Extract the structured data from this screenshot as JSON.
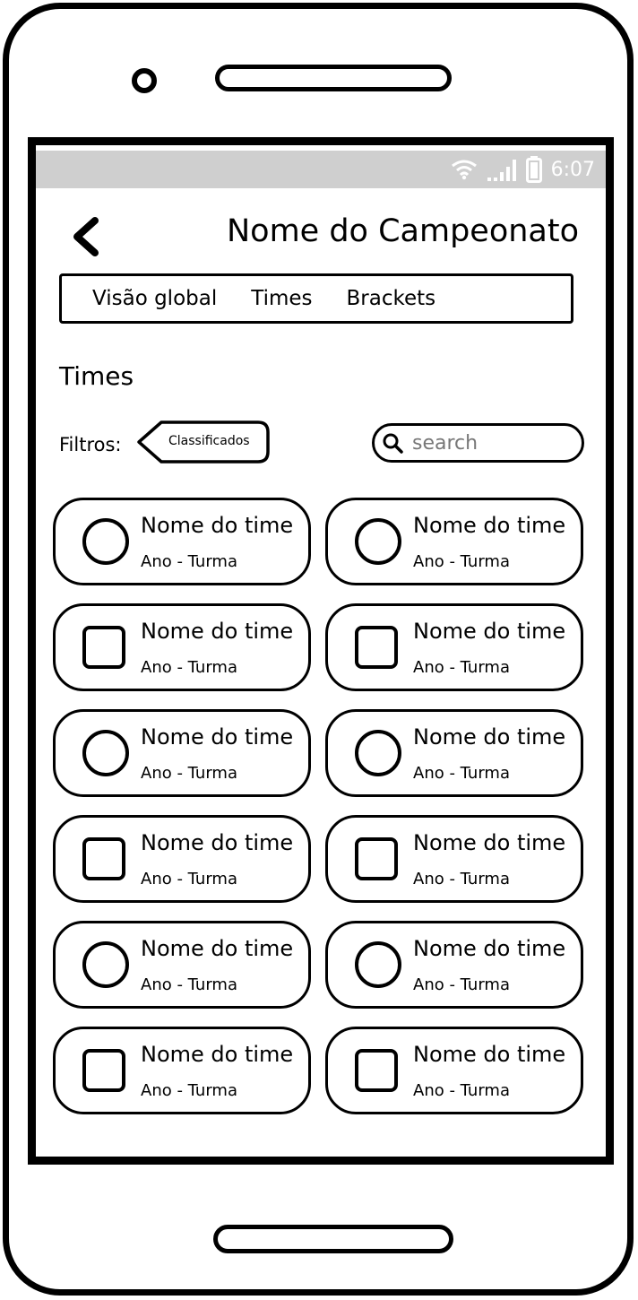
{
  "status_bar": {
    "time": "6:07",
    "icons": [
      "wifi-icon",
      "signal-icon",
      "battery-icon"
    ]
  },
  "header": {
    "back_icon": "chevron-left-icon",
    "title": "Nome do Campeonato"
  },
  "tabs": [
    {
      "label": "Visão global"
    },
    {
      "label": "Times"
    },
    {
      "label": "Brackets"
    }
  ],
  "section": {
    "title": "Times"
  },
  "filters": {
    "label": "Filtros:",
    "chip": "Classificados"
  },
  "search": {
    "placeholder": "search",
    "icon": "search-icon"
  },
  "teams": [
    {
      "name": "Nome do time",
      "subtitle": "Ano - Turma",
      "shape": "circle"
    },
    {
      "name": "Nome do time",
      "subtitle": "Ano - Turma",
      "shape": "circle"
    },
    {
      "name": "Nome do time",
      "subtitle": "Ano - Turma",
      "shape": "square"
    },
    {
      "name": "Nome do time",
      "subtitle": "Ano - Turma",
      "shape": "square"
    },
    {
      "name": "Nome do time",
      "subtitle": "Ano - Turma",
      "shape": "circle"
    },
    {
      "name": "Nome do time",
      "subtitle": "Ano - Turma",
      "shape": "circle"
    },
    {
      "name": "Nome do time",
      "subtitle": "Ano - Turma",
      "shape": "square"
    },
    {
      "name": "Nome do time",
      "subtitle": "Ano - Turma",
      "shape": "square"
    },
    {
      "name": "Nome do time",
      "subtitle": "Ano - Turma",
      "shape": "circle"
    },
    {
      "name": "Nome do time",
      "subtitle": "Ano - Turma",
      "shape": "circle"
    },
    {
      "name": "Nome do time",
      "subtitle": "Ano - Turma",
      "shape": "square"
    },
    {
      "name": "Nome do time",
      "subtitle": "Ano - Turma",
      "shape": "square"
    }
  ]
}
